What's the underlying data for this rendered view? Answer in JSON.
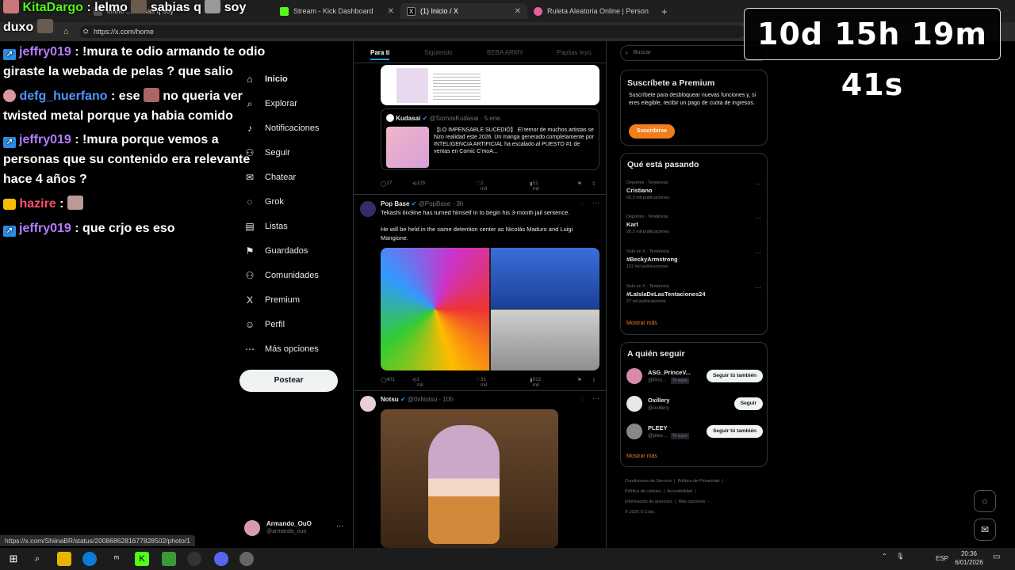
{
  "browser": {
    "tabs": [
      {
        "label": "lmelo ... sabias q soy",
        "color": "#555555"
      },
      {
        "label": "Stream - Kick Dashboard",
        "color": "#53fc18"
      },
      {
        "label": "(1) Inicio / X",
        "color": "#000000"
      },
      {
        "label": "Ruleta Aleatoria Online | Person",
        "color": "#e85d9b"
      }
    ],
    "url": "https://x.com/home",
    "new_tab": "+",
    "status_url": "https://x.com/ShiinaBR/status/2008686281677828502/photo/1",
    "window_controls": [
      "–",
      "□",
      "✕"
    ]
  },
  "chat": {
    "top_user": "KitaDargo",
    "top_message": ": lelmo",
    "top_message2": "sabias q",
    "top_message3": "soy",
    "top_message4": "duxo",
    "messages": [
      {
        "user": "jeffry019",
        "user_color": "#b47cff",
        "text": ": !mura te odio armando te odio giraste la webada de pelas ? que salio",
        "badge": "kick"
      },
      {
        "user": "defg_huerfano",
        "user_color": "#4f94ff",
        "text_a": ": ese",
        "text_b": "no queria ver twisted metal porque ya habia comido",
        "badge": "avatar"
      },
      {
        "user": "jeffry019",
        "user_color": "#b47cff",
        "text": ": !mura porque vemos a personas que su contenido era relevante hace 4 años ?",
        "badge": "kick"
      },
      {
        "user": "hazire",
        "user_color": "#ff4f6d",
        "text": ":",
        "badge": "crown"
      },
      {
        "user": "jeffry019",
        "user_color": "#b47cff",
        "text": ": que crjo es eso",
        "badge": "kick"
      }
    ]
  },
  "timer": {
    "text": "10d 15h 19m 41s"
  },
  "xnav": {
    "items": [
      {
        "label": "Inicio",
        "icon": "home-icon",
        "glyph": "⌂"
      },
      {
        "label": "Explorar",
        "icon": "search-icon",
        "glyph": "⌕"
      },
      {
        "label": "Notificaciones",
        "icon": "bell-icon",
        "glyph": "♪"
      },
      {
        "label": "Seguir",
        "icon": "follow-icon",
        "glyph": "⚇"
      },
      {
        "label": "Chatear",
        "icon": "mail-icon",
        "glyph": "✉"
      },
      {
        "label": "Grok",
        "icon": "grok-icon",
        "glyph": "◌"
      },
      {
        "label": "Listas",
        "icon": "list-icon",
        "glyph": "▤"
      },
      {
        "label": "Guardados",
        "icon": "bookmark-icon",
        "glyph": "⚑"
      },
      {
        "label": "Comunidades",
        "icon": "communities-icon",
        "glyph": "⚇"
      },
      {
        "label": "Premium",
        "icon": "x-logo-icon",
        "glyph": "X"
      },
      {
        "label": "Perfil",
        "icon": "profile-icon",
        "glyph": "☺"
      },
      {
        "label": "Más opciones",
        "icon": "more-icon",
        "glyph": "⋯"
      }
    ],
    "post_label": "Postear",
    "profile_name": "Armando_OuO",
    "profile_handle": "@armando_ouo",
    "profile_more": "⋯"
  },
  "timeline": {
    "tabs": [
      "Para ti",
      "Siguiendo",
      "BEBA ARMY",
      "Papitas leyo"
    ],
    "quote": {
      "name": "Kudasai",
      "handle": "@SomosKudasai · 5 ene.",
      "text": "【LO IMPENSABLE SUCEDIÓ】 El temor de muchos artistas se hizo realidad este 2026. Un manga generado completamente por INTELIGENCIA ARTIFICIAL ha escalado al PUESTO #1 de ventas en Comic C'moA..."
    },
    "actions1": {
      "replies": "27",
      "reposts": "125",
      "likes": "2 mil",
      "views": "51 mil"
    },
    "tweet2": {
      "name": "Pop Base",
      "handle": "@PopBase · 3h",
      "text1": "Tekashi 6ix9ine has turned himself in to begin his 3-month jail sentence.",
      "text2": "He will be held in the same detention center as Nicolás Maduro and Luigi Mangione."
    },
    "actions2": {
      "replies": "401",
      "reposts": "1 mil",
      "likes": "31 mil",
      "views": "912 mil"
    },
    "tweet3": {
      "name": "Notsu",
      "handle": "@0xNotsu · 10h"
    }
  },
  "right": {
    "search_placeholder": "Buscar",
    "premium": {
      "title": "Suscríbete a Premium",
      "text": "Suscríbete para desbloquear nuevas funciones y, si eres elegible, recibir un pago de cuota de ingresos.",
      "button": "Suscribirse"
    },
    "trends_title": "Qué está pasando",
    "trends": [
      {
        "meta": "Deportes · Tendencia",
        "name": "Cristiano",
        "count": "65,3 mil publicaciones"
      },
      {
        "meta": "Deportes · Tendencia",
        "name": "Karl",
        "count": "26,5 mil publicaciones"
      },
      {
        "meta": "Solo en X · Tendencia",
        "name": "#BeckyArmstrong",
        "count": "122 mil publicaciones"
      },
      {
        "meta": "Solo en X · Tendencia",
        "name": "#LaIslaDeLasTentaciones24",
        "count": "27 mil publicaciones"
      }
    ],
    "show_more": "Mostrar más",
    "follow_title": "A quién seguir",
    "follows": [
      {
        "name": "ASG_PrinceV...",
        "handle": "@Prin...",
        "tag": "Te sigue",
        "button": "Seguir tú también",
        "color": "#d88aa8"
      },
      {
        "name": "Oxillery",
        "handle": "@oxillery",
        "tag": "",
        "button": "Seguir",
        "color": "#e8e8e8"
      },
      {
        "name": "PLEEY",
        "handle": "@plee...",
        "tag": "Te sigue",
        "button": "Seguir tú también",
        "color": "#888888"
      }
    ],
    "footer": [
      "Condiciones de Servicio",
      "Política de Privacidad",
      "Política de cookies",
      "Accesibilidad",
      "Información de anuncios",
      "Más opciones ···",
      "© 2026 X Corp."
    ]
  },
  "taskbar": {
    "lang": "ESP",
    "time": "20:36",
    "date": "6/01/2026"
  }
}
